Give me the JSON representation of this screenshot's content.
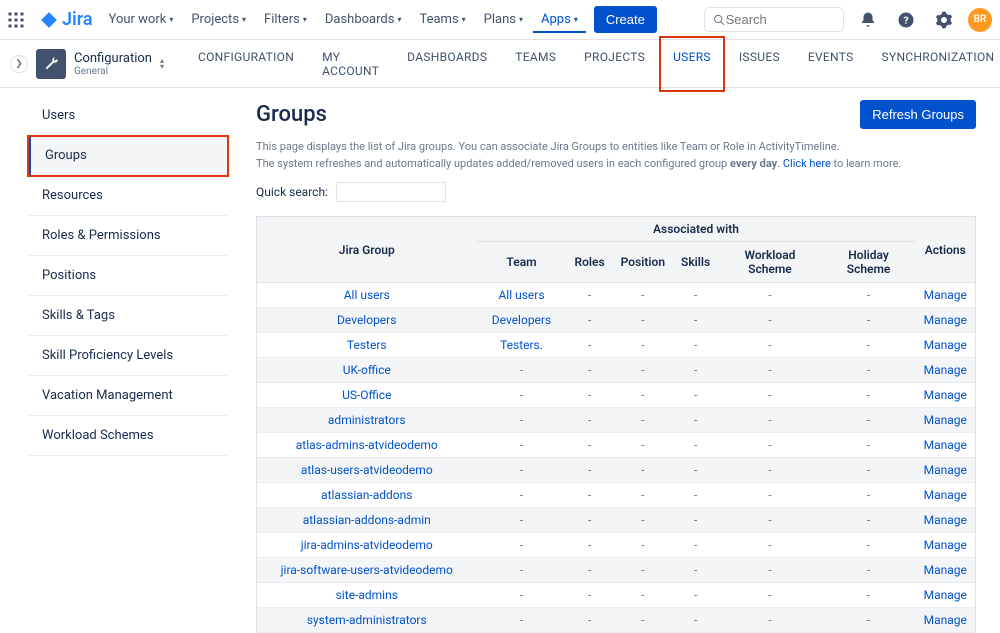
{
  "brand": "Jira",
  "topnav": {
    "items": [
      "Your work",
      "Projects",
      "Filters",
      "Dashboards",
      "Teams",
      "Plans",
      "Apps"
    ],
    "create": "Create",
    "search_placeholder": "Search",
    "avatar": "BR"
  },
  "config": {
    "title": "Configuration",
    "subtitle": "General"
  },
  "subtabs": [
    "CONFIGURATION",
    "MY ACCOUNT",
    "DASHBOARDS",
    "TEAMS",
    "PROJECTS",
    "USERS",
    "ISSUES",
    "EVENTS",
    "SYNCHRONIZATION"
  ],
  "sidebar": [
    "Users",
    "Groups",
    "Resources",
    "Roles & Permissions",
    "Positions",
    "Skills & Tags",
    "Skill Proficiency Levels",
    "Vacation Management",
    "Workload Schemes"
  ],
  "page": {
    "title": "Groups",
    "refresh": "Refresh Groups",
    "desc1": "This page displays the list of Jira groups. You can associate Jira Groups to entities like Team or Role in ActivityTimeline.",
    "desc2a": "The system refreshes and automatically updates added/removed users in each configured group ",
    "desc2b": "every day",
    "desc2c": ". ",
    "desc_link": "Click here",
    "desc2d": " to learn more.",
    "quick_search": "Quick search:"
  },
  "table": {
    "assoc": "Associated with",
    "headers": [
      "Jira Group",
      "Team",
      "Roles",
      "Position",
      "Skills",
      "Workload Scheme",
      "Holiday Scheme",
      "Actions"
    ],
    "action": "Manage",
    "rows": [
      {
        "group": "All users",
        "team": "All users"
      },
      {
        "group": "Developers",
        "team": "Developers"
      },
      {
        "group": "Testers",
        "team": "Testers."
      },
      {
        "group": "UK-office",
        "team": "-"
      },
      {
        "group": "US-Office",
        "team": "-"
      },
      {
        "group": "administrators",
        "team": "-"
      },
      {
        "group": "atlas-admins-atvideodemo",
        "team": "-"
      },
      {
        "group": "atlas-users-atvideodemo",
        "team": "-"
      },
      {
        "group": "atlassian-addons",
        "team": "-"
      },
      {
        "group": "atlassian-addons-admin",
        "team": "-"
      },
      {
        "group": "jira-admins-atvideodemo",
        "team": "-"
      },
      {
        "group": "jira-software-users-atvideodemo",
        "team": "-"
      },
      {
        "group": "site-admins",
        "team": "-"
      },
      {
        "group": "system-administrators",
        "team": "-"
      }
    ]
  }
}
